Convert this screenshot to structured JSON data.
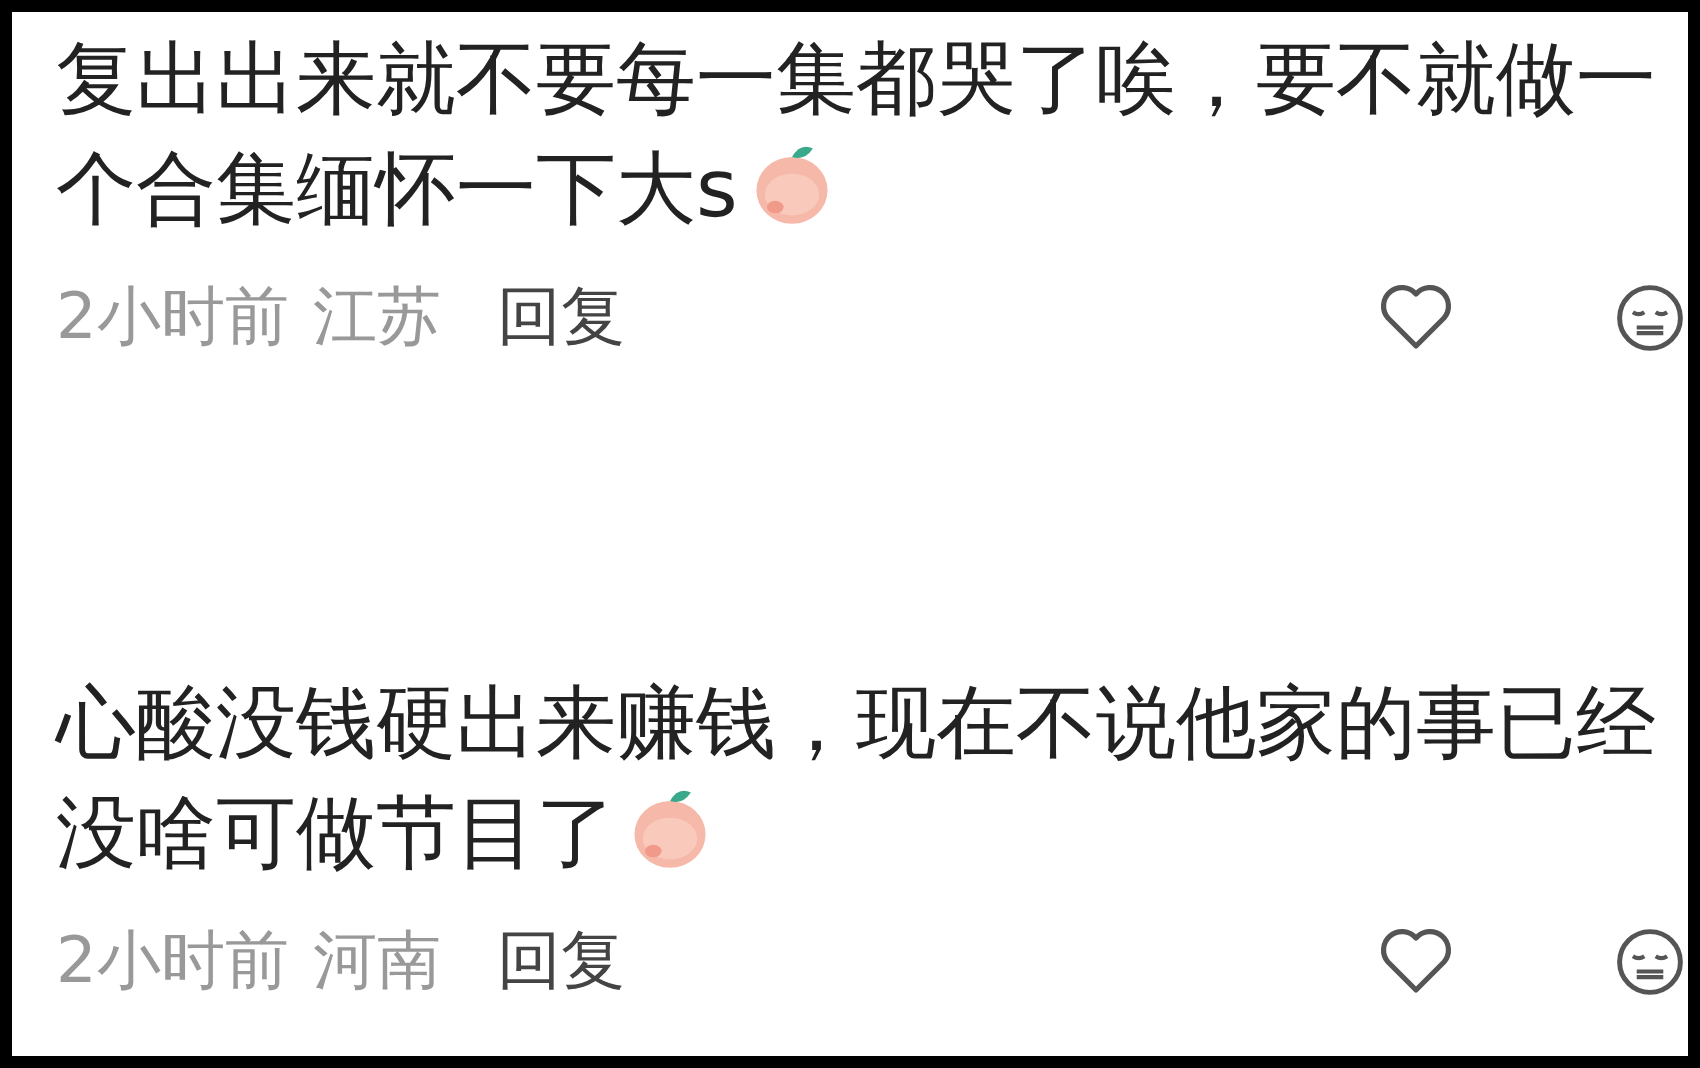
{
  "comments": [
    {
      "text": "复出出来就不要每一集都哭了唉，要不就做一个合集缅怀一下大s",
      "sticker": true,
      "time": "2小时前",
      "location": "江苏",
      "reply": "回复",
      "liked": false
    },
    {
      "text": "心酸没钱硬出来赚钱，现在不说他家的事已经没啥可做节目了",
      "sticker": true,
      "time": "2小时前",
      "location": "河南",
      "reply": "回复",
      "liked": false
    }
  ]
}
